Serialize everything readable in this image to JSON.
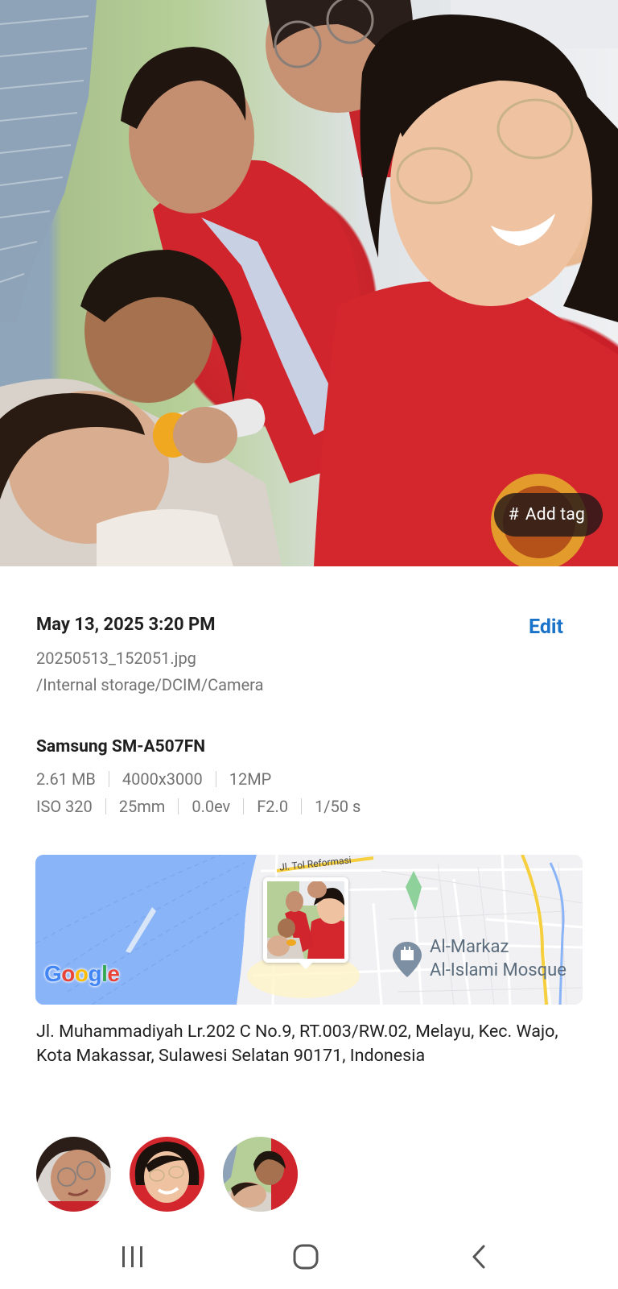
{
  "photo": {
    "tag_label": "Add tag",
    "tag_icon": "hash-icon"
  },
  "details": {
    "datetime": "May 13, 2025 3:20 PM",
    "edit_label": "Edit",
    "filename": "20250513_152051.jpg",
    "path": "/Internal storage/DCIM/Camera",
    "device": "Samsung SM-A507FN",
    "specs": [
      "2.61 MB",
      "4000x3000",
      "12MP"
    ],
    "exif": [
      "ISO 320",
      "25mm",
      "0.0ev",
      "F2.0",
      "1/50 s"
    ]
  },
  "map": {
    "road_label": "Jl. Tol Reformasi",
    "poi_label_line1": "Al-Markaz",
    "poi_label_line2": "Al-Islami Mosque",
    "logo": "Google",
    "water_color": "#8ab4f8",
    "road_color": "#f6cf3f"
  },
  "address": "Jl. Muhammadiyah Lr.202 C No.9, RT.003/RW.02, Melayu, Kec. Wajo, Kota Makassar, Sulawesi Selatan 90171, Indonesia",
  "faces": [
    "face-1",
    "face-2",
    "face-3"
  ],
  "navbar": {
    "recents_icon": "recents-icon",
    "home_icon": "home-icon",
    "back_icon": "back-icon"
  },
  "colors": {
    "accent": "#1a73c9",
    "jacket_red": "#c91f28"
  }
}
